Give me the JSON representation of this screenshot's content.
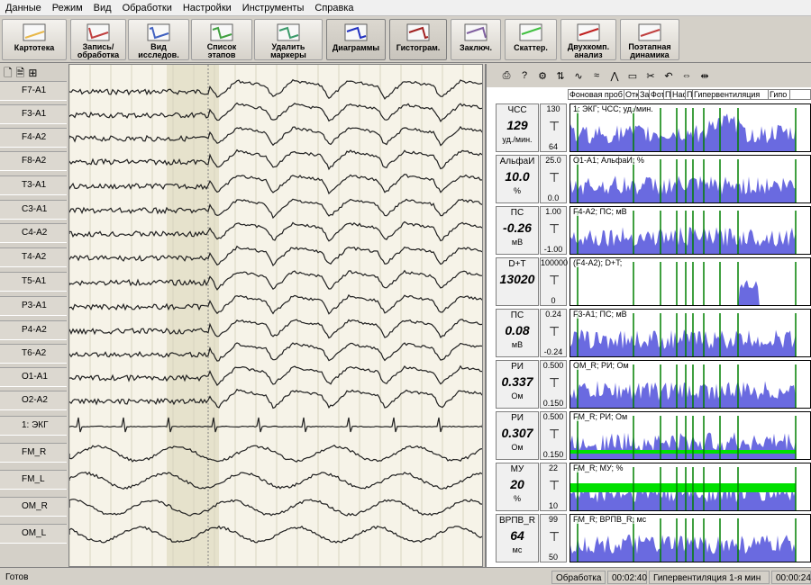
{
  "menu": [
    "Данные",
    "Режим",
    "Вид",
    "Обработки",
    "Настройки",
    "Инструменты",
    "Справка"
  ],
  "toolbar": [
    {
      "label": "Картотека",
      "icon": "card-index-icon"
    },
    {
      "label": "Запись/\nобработка",
      "icon": "record-process-icon"
    },
    {
      "label": "Вид\nисследов.",
      "icon": "study-view-icon"
    },
    {
      "label": "Список\nэтапов",
      "icon": "stage-list-icon"
    },
    {
      "label": "Удалить\nмаркеры",
      "icon": "delete-markers-icon"
    },
    {
      "label": "Диаграммы",
      "icon": "diagrams-icon"
    },
    {
      "label": "Гистограм.",
      "icon": "histogram-icon"
    },
    {
      "label": "Заключ.",
      "icon": "conclusion-icon"
    },
    {
      "label": "Скаттер.",
      "icon": "scatter-icon"
    },
    {
      "label": "Двухкомп.\nанализ",
      "icon": "two-component-icon"
    },
    {
      "label": "Поэтапная\nдинамика",
      "icon": "stage-dynamics-icon"
    }
  ],
  "channels": [
    "F7-A1",
    "F3-A1",
    "F4-A2",
    "F8-A2",
    "T3-A1",
    "C3-A1",
    "C4-A2",
    "T4-A2",
    "T5-A1",
    "P3-A1",
    "P4-A2",
    "T6-A2",
    "O1-A1",
    "O2-A2",
    "1: ЭКГ",
    "FM_R",
    "FM_L",
    "OM_R",
    "OM_L"
  ],
  "stages_header": [
    "Фоновая проб",
    "Отк",
    "Зак",
    "Фот",
    "П",
    "Нас",
    "П",
    "Гипервентиляция",
    "Гипо"
  ],
  "trends": [
    {
      "name": "ЧСС",
      "value": "129",
      "unit": "уд./мин.",
      "scale_top": "130",
      "scale_bottom": "64",
      "title": "1: ЭКГ; ЧСС; уд./мин."
    },
    {
      "name": "АльфаИ",
      "value": "10.0",
      "unit": "%",
      "scale_top": "25.0",
      "scale_bottom": "0.0",
      "title": "O1-A1; АльфаИ; %"
    },
    {
      "name": "ПС",
      "value": "-0.26",
      "unit": "мВ",
      "scale_top": "1.00",
      "scale_bottom": "-1.00",
      "title": "F4-A2; ПС; мВ"
    },
    {
      "name": "D+T",
      "value": "13020",
      "unit": "",
      "scale_top": "100000",
      "scale_bottom": "0",
      "title": "(F4-A2); D+T;"
    },
    {
      "name": "ПС",
      "value": "0.08",
      "unit": "мВ",
      "scale_top": "0.24",
      "scale_bottom": "-0.24",
      "title": "F3-A1; ПС; мВ"
    },
    {
      "name": "РИ",
      "value": "0.337",
      "unit": "Ом",
      "scale_top": "0.500",
      "scale_bottom": "0.150",
      "title": "OM_R; РИ; Ом"
    },
    {
      "name": "РИ",
      "value": "0.307",
      "unit": "Ом",
      "scale_top": "0.500",
      "scale_bottom": "0.150",
      "title": "FM_R; РИ; Ом"
    },
    {
      "name": "МУ",
      "value": "20",
      "unit": "%",
      "scale_top": "22",
      "scale_bottom": "10",
      "title": "FM_R; МУ; %"
    },
    {
      "name": "ВРПВ_R",
      "value": "64",
      "unit": "мс",
      "scale_top": "99",
      "scale_bottom": "50",
      "title": "FM_R; ВРПВ_R; мс"
    }
  ],
  "status": {
    "ready": "Готов",
    "mode": "Обработка",
    "time1": "00:02:40",
    "stage": "Гипервентиляция  1-я мин",
    "time2": "00:00:24"
  },
  "colors": {
    "trend_fill": "#6a6ae0",
    "marker": "#008000",
    "green_band": "#00e000"
  }
}
